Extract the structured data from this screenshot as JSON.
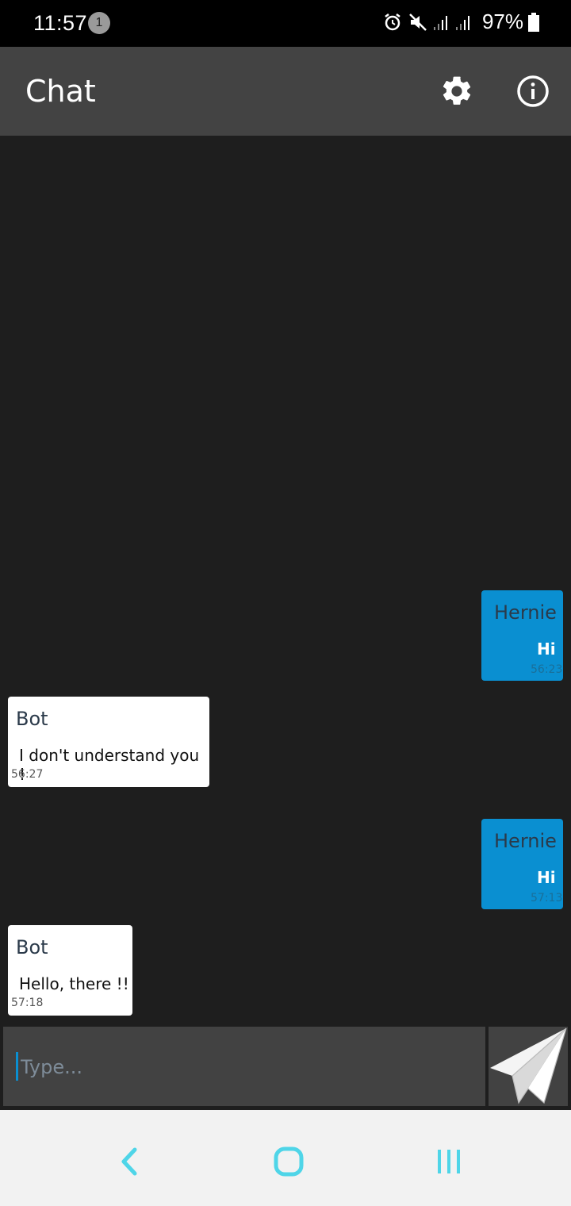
{
  "status_bar": {
    "time": "11:57",
    "notification_count": "1",
    "battery_percent": "97%",
    "icons": [
      "alarm-icon",
      "mute-icon",
      "signal-icon",
      "signal-icon",
      "battery-icon"
    ]
  },
  "app_bar": {
    "title": "Chat",
    "actions": [
      "settings-icon",
      "info-icon"
    ]
  },
  "messages": [
    {
      "role": "user",
      "sender": "Hernie",
      "text": "Hi",
      "time": "56:23"
    },
    {
      "role": "bot",
      "sender": "Bot",
      "text": "I don't understand you !",
      "time": "56:27"
    },
    {
      "role": "user",
      "sender": "Hernie",
      "text": "Hi",
      "time": "57:13"
    },
    {
      "role": "bot",
      "sender": "Bot",
      "text": "Hello, there !!",
      "time": "57:18"
    }
  ],
  "composer": {
    "placeholder": "Type...",
    "value": "",
    "send_icon": "paper-plane-icon"
  },
  "nav_bar": {
    "buttons": [
      "back-icon",
      "home-icon",
      "recent-apps-icon"
    ]
  },
  "colors": {
    "background": "#1e1e1e",
    "app_bar": "#434343",
    "user_bubble": "#0a8fd1",
    "bot_bubble": "#ffffff",
    "nav_icons": "#4fd5e8"
  }
}
